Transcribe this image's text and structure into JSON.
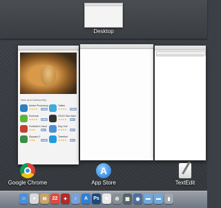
{
  "spaces": {
    "desktop_label": "Desktop"
  },
  "apps": [
    {
      "label": "Google Chrome",
      "icon": "chrome-icon"
    },
    {
      "label": "App Store",
      "icon": "app-store-icon"
    },
    {
      "label": "TextEdit",
      "icon": "textedit-icon"
    }
  ],
  "app_store_window": {
    "section_title": "New and Noteworthy",
    "apps": [
      {
        "name": "Adobe Photoshop",
        "stars": "★★★★",
        "price": "FREE",
        "color": "#2d7fc1"
      },
      {
        "name": "Twitter",
        "stars": "★★★★",
        "price": "FREE",
        "color": "#3fa9e0"
      },
      {
        "name": "Evernote",
        "stars": "★★★★",
        "price": "FREE",
        "color": "#5fb23a"
      },
      {
        "name": "LEGO Star Wars",
        "stars": "★★★★",
        "price": "BUY",
        "color": "#333333"
      },
      {
        "name": "Football In Hand",
        "stars": "★★★",
        "price": "BUY",
        "color": "#c2412f"
      },
      {
        "name": "Day One",
        "stars": "★★★★",
        "price": "BUY",
        "color": "#4a8fd8"
      },
      {
        "name": "Skyward 2",
        "stars": "★★★",
        "price": "FREE",
        "color": "#3a8d4a"
      },
      {
        "name": "Tweetbot",
        "stars": "★★★★",
        "price": "BUY",
        "color": "#1f9bde"
      }
    ]
  },
  "dock": {
    "icons": [
      {
        "name": "finder-icon",
        "glyph": "☺",
        "color": "#4a8fd8"
      },
      {
        "name": "chrome-dock-icon",
        "glyph": "●",
        "color": "#d9d9d9"
      },
      {
        "name": "mail-stamp-icon",
        "glyph": "✉",
        "color": "#c9a46a"
      },
      {
        "name": "calendar-icon",
        "glyph": "22",
        "color": "#e04a3f"
      },
      {
        "name": "photo-booth-icon",
        "glyph": "✦",
        "color": "#b22a2a"
      },
      {
        "name": "itunes-icon",
        "glyph": "♪",
        "color": "#7aa0d8"
      },
      {
        "name": "app-store-dock-icon",
        "glyph": "A",
        "color": "#2d7fd8"
      },
      {
        "name": "photoshop-icon",
        "glyph": "Ps",
        "color": "#1e4a7a"
      },
      {
        "name": "pages-icon",
        "glyph": "✎",
        "color": "#e9e9e9"
      },
      {
        "name": "system-prefs-icon",
        "glyph": "⚙",
        "color": "#8a8f96"
      },
      {
        "name": "activity-icon",
        "glyph": "▦",
        "color": "#566"
      },
      {
        "name": "preview-icon",
        "glyph": "◉",
        "color": "#4a6fa0"
      },
      {
        "name": "folder-icon",
        "glyph": "▬",
        "color": "#6fa8dc"
      },
      {
        "name": "downloads-icon",
        "glyph": "▬",
        "color": "#6fa8dc"
      },
      {
        "name": "trash-icon",
        "glyph": "▮",
        "color": "#a0a6ad"
      }
    ]
  }
}
